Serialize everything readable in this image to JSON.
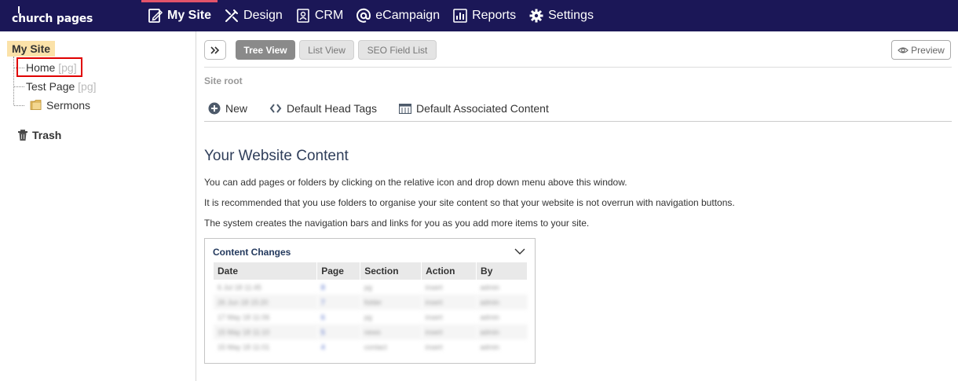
{
  "app": {
    "logo_text": "church pages"
  },
  "nav": [
    {
      "label": "My Site",
      "icon": "edit-page-icon",
      "active": true
    },
    {
      "label": "Design",
      "icon": "design-tools-icon"
    },
    {
      "label": "CRM",
      "icon": "contact-card-icon"
    },
    {
      "label": "eCampaign",
      "icon": "at-sign-icon"
    },
    {
      "label": "Reports",
      "icon": "bar-chart-icon"
    },
    {
      "label": "Settings",
      "icon": "gear-icon"
    }
  ],
  "sidebar": {
    "root_label": "My Site",
    "items": [
      {
        "label": "Home",
        "suffix": "[pg]"
      },
      {
        "label": "Test Page",
        "suffix": "[pg]"
      },
      {
        "label": "Sermons",
        "icon": "folder-icon"
      }
    ],
    "trash_label": "Trash"
  },
  "toolbar": {
    "tree_view": "Tree View",
    "list_view": "List View",
    "seo_field_list": "SEO Field List",
    "preview": "Preview"
  },
  "main": {
    "site_root": "Site root",
    "actions": {
      "new": "New",
      "head_tags": "Default Head Tags",
      "associated_content": "Default Associated Content"
    },
    "title": "Your Website Content",
    "paragraphs": [
      "You can add pages or folders by clicking on the relative icon and drop down menu above this window.",
      "It is recommended that you use folders to organise your site content so that your website is not overrun with navigation buttons.",
      "The system creates the navigation bars and links for you as you add more items to your site."
    ]
  },
  "content_changes": {
    "title": "Content Changes",
    "columns": [
      "Date",
      "Page",
      "Section",
      "Action",
      "By"
    ],
    "rows": [
      [
        "6 Jul 18 11:45",
        "8",
        "pg",
        "insert",
        "admin"
      ],
      [
        "26 Jun 18 15:20",
        "7",
        "folder",
        "insert",
        "admin"
      ],
      [
        "17 May 18 11:06",
        "6",
        "pg",
        "insert",
        "admin"
      ],
      [
        "15 May 18 11:10",
        "5",
        "news",
        "insert",
        "admin"
      ],
      [
        "15 May 18 11:01",
        "4",
        "contact",
        "insert",
        "admin"
      ]
    ]
  },
  "colors": {
    "topbar": "#1b1757",
    "active_accent": "#e2536a",
    "site_label_bg": "#fbe2a9",
    "highlight_box": "#e00000"
  }
}
